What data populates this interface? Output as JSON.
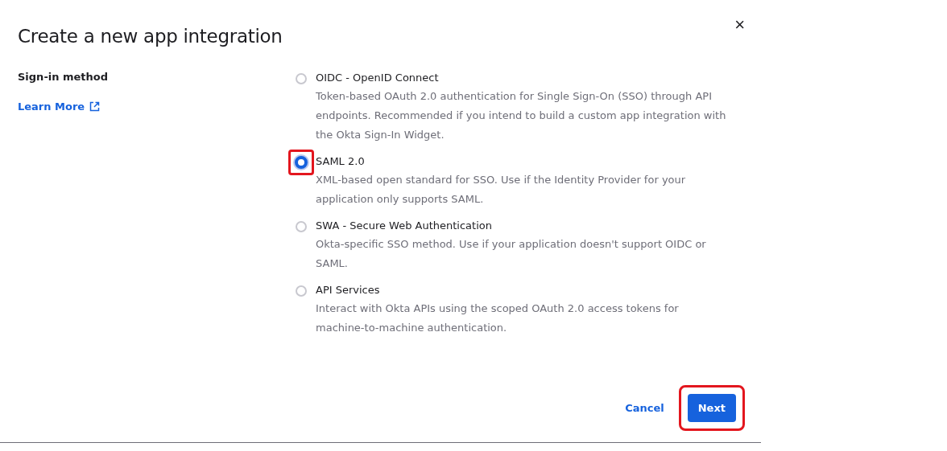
{
  "dialog": {
    "title": "Create a new app integration",
    "close_icon": "×"
  },
  "sign_in_method": {
    "label": "Sign-in method",
    "learn_more": "Learn More",
    "options": [
      {
        "label": "OIDC - OpenID Connect",
        "description": "Token-based OAuth 2.0 authentication for Single Sign-On (SSO) through API endpoints. Recommended if you intend to build a custom app integration with the Okta Sign-In Widget.",
        "selected": false,
        "highlighted": false
      },
      {
        "label": "SAML 2.0",
        "description": "XML-based open standard for SSO. Use if the Identity Provider for your application only supports SAML.",
        "selected": true,
        "highlighted": true
      },
      {
        "label": "SWA - Secure Web Authentication",
        "description": "Okta-specific SSO method. Use if your application doesn't support OIDC or SAML.",
        "selected": false,
        "highlighted": false
      },
      {
        "label": "API Services",
        "description": "Interact with Okta APIs using the scoped OAuth 2.0 access tokens for machine-to-machine authentication.",
        "selected": false,
        "highlighted": false
      }
    ]
  },
  "footer": {
    "cancel": "Cancel",
    "next": {
      "label": "Next",
      "highlighted": true
    }
  }
}
